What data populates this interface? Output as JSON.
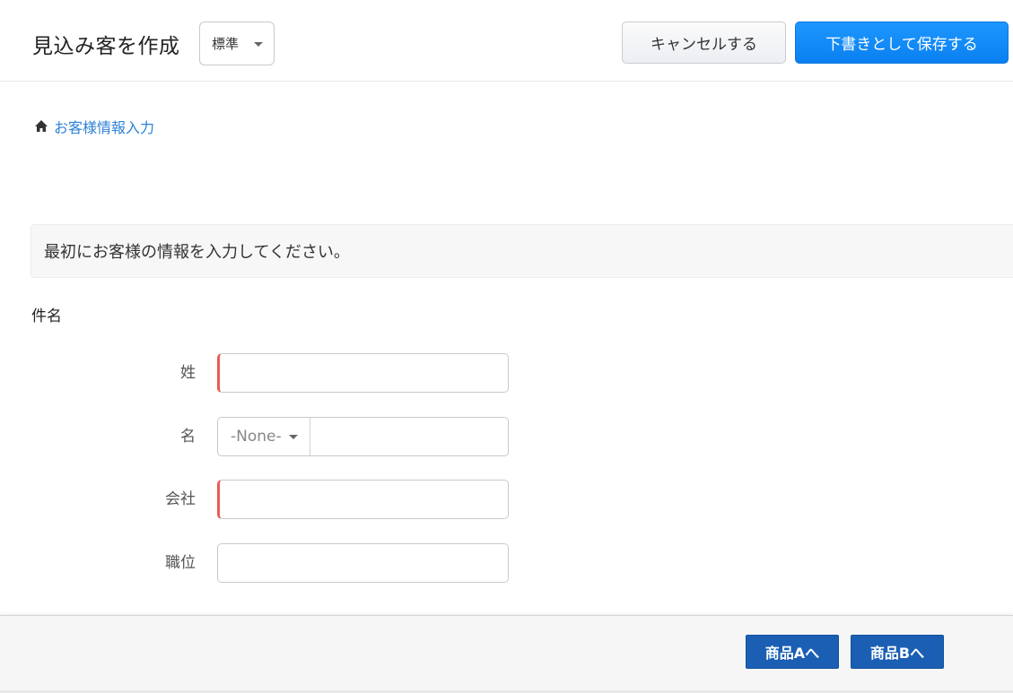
{
  "header": {
    "title": "見込み客を作成",
    "layout_select": "標準",
    "cancel_label": "キャンセルする",
    "save_draft_label": "下書きとして保存する"
  },
  "breadcrumb": {
    "icon": "home-icon",
    "label": "お客様情報入力"
  },
  "banner": {
    "text": "最初にお客様の情報を入力してください。"
  },
  "section": {
    "title": "件名"
  },
  "form": {
    "last_name": {
      "label": "姓",
      "value": ""
    },
    "first_name": {
      "label": "名",
      "salutation": "-None-",
      "value": ""
    },
    "company": {
      "label": "会社",
      "value": ""
    },
    "job_title": {
      "label": "職位",
      "value": ""
    }
  },
  "footer": {
    "product_a_label": "商品Aへ",
    "product_b_label": "商品Bへ"
  },
  "colors": {
    "primary_button": "#0a80f0",
    "required_marker": "#ea5c55",
    "link": "#2d82d6",
    "footer_button": "#1a5fb4"
  }
}
